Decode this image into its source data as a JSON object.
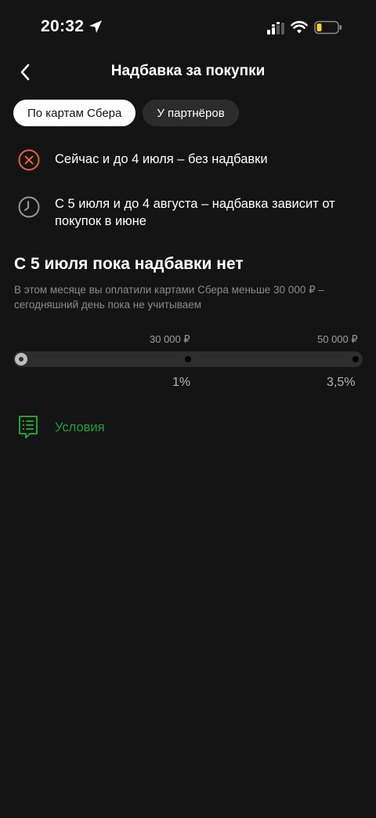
{
  "status_bar": {
    "time": "20:32"
  },
  "header": {
    "title": "Надбавка за покупки"
  },
  "tabs": [
    {
      "label": "По картам Сбера",
      "active": true
    },
    {
      "label": "У партнёров",
      "active": false
    }
  ],
  "info_rows": [
    {
      "icon": "cross-circle-icon",
      "text": "Сейчас и до 4 июля – без надбавки",
      "icon_color": "#e5633a"
    },
    {
      "icon": "clock-icon",
      "text": "С 5 июля и до 4 августа – надбавка зависит от покупок в июне",
      "icon_color": "#9a9a9a"
    }
  ],
  "section": {
    "title": "С 5 июля пока надбавки нет",
    "subtitle": "В этом месяце вы оплатили картами Сбера меньше 30 000 ₽ – сегодняшний день пока не учитываем"
  },
  "progress": {
    "thresholds": [
      "30 000 ₽",
      "50 000 ₽"
    ],
    "rates": [
      "1%",
      "3,5%"
    ],
    "current_fraction": 0
  },
  "conditions": {
    "label": "Условия",
    "icon": "document-icon"
  },
  "colors": {
    "background": "#141414",
    "accent_green": "#21a038",
    "warning_orange": "#e5633a",
    "muted_text": "#8a8a8a"
  }
}
